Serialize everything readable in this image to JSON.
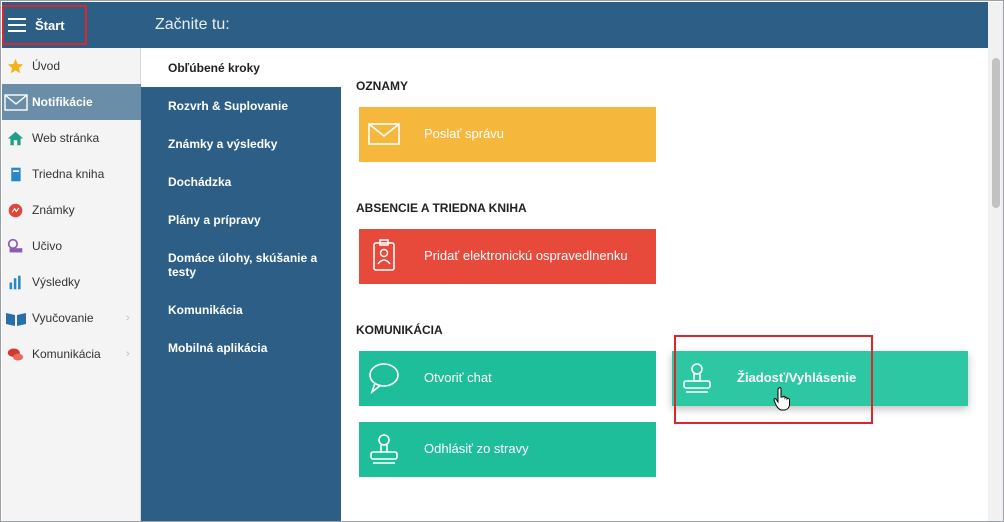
{
  "sidebar": {
    "start_label": "Štart",
    "items": [
      {
        "label": "Úvod",
        "icon": "star-icon"
      },
      {
        "label": "Notifikácie",
        "icon": "envelope-icon",
        "active": true
      },
      {
        "label": "Web stránka",
        "icon": "home-icon"
      },
      {
        "label": "Triedna kniha",
        "icon": "book-icon"
      },
      {
        "label": "Známky",
        "icon": "grades-icon"
      },
      {
        "label": "Učivo",
        "icon": "curriculum-icon"
      },
      {
        "label": "Výsledky",
        "icon": "bar-chart-icon"
      },
      {
        "label": "Vyučovanie",
        "icon": "open-book-icon",
        "has_submenu": true
      },
      {
        "label": "Komunikácia",
        "icon": "chat-bubbles-icon",
        "has_submenu": true
      }
    ]
  },
  "header": {
    "title": "Začnite tu:"
  },
  "categories": [
    {
      "label": "Obľúbené kroky",
      "active": true
    },
    {
      "label": "Rozvrh & Suplovanie"
    },
    {
      "label": "Známky a výsledky"
    },
    {
      "label": "Dochádzka"
    },
    {
      "label": "Plány a prípravy"
    },
    {
      "label": "Domáce úlohy, skúšanie a testy"
    },
    {
      "label": "Komunikácia"
    },
    {
      "label": "Mobilná aplikácia"
    }
  ],
  "sections": {
    "oznamy": {
      "title": "OZNAMY",
      "tiles": [
        {
          "label": "Poslať správu",
          "icon": "envelope-icon",
          "color": "#f5b83c"
        }
      ]
    },
    "absencie": {
      "title": "ABSENCIE A TRIEDNA KNIHA",
      "tiles": [
        {
          "label": "Pridať elektronickú ospravedlnenku",
          "icon": "badge-icon",
          "color": "#e7493b"
        }
      ]
    },
    "komunikacia": {
      "title": "KOMUNIKÁCIA",
      "tiles": [
        {
          "label": "Otvoriť chat",
          "icon": "speech-bubble-icon",
          "color": "#1fbe9a"
        },
        {
          "label": "Žiadosť/Vyhlásenie",
          "icon": "stamp-icon",
          "color": "#2dc7a4",
          "hovered": true
        },
        {
          "label": "Odhlásiť zo stravy",
          "icon": "stamp-icon",
          "color": "#1fbe9a"
        }
      ]
    }
  },
  "colors": {
    "primary": "#2d5f86",
    "highlight": "#d9272e",
    "active_nav": "#6b8ea8"
  }
}
